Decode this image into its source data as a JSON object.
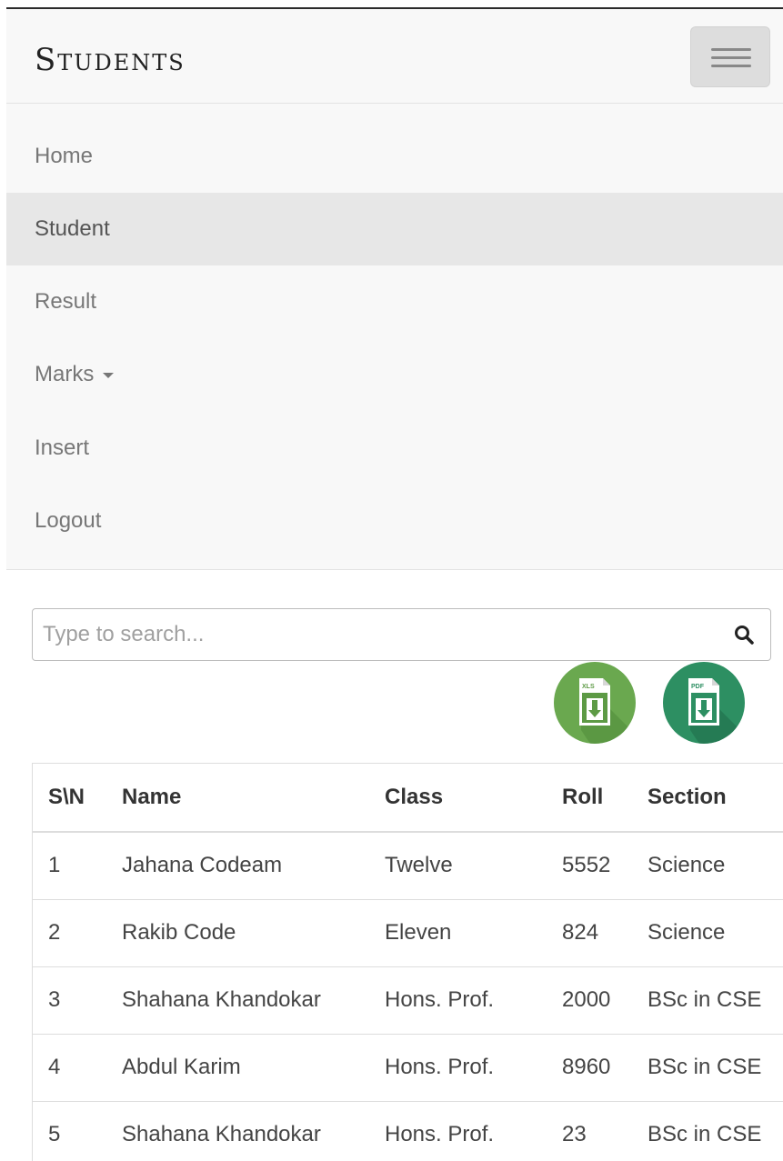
{
  "brand": "Students",
  "nav": {
    "items": [
      {
        "label": "Home"
      },
      {
        "label": "Student",
        "active": true
      },
      {
        "label": "Result"
      },
      {
        "label": "Marks",
        "dropdown": true
      },
      {
        "label": "Insert"
      },
      {
        "label": "Logout"
      }
    ]
  },
  "search": {
    "placeholder": "Type to search...",
    "value": ""
  },
  "exports": {
    "xls_label": "XLS",
    "pdf_label": "PDF"
  },
  "table": {
    "headers": [
      "S\\N",
      "Name",
      "Class",
      "Roll",
      "Section"
    ],
    "rows": [
      [
        "1",
        "Jahana Codeam",
        "Twelve",
        "5552",
        "Science"
      ],
      [
        "2",
        "Rakib Code",
        "Eleven",
        "824",
        "Science"
      ],
      [
        "3",
        "Shahana Khandokar",
        "Hons. Prof.",
        "2000",
        "BSc in CSE"
      ],
      [
        "4",
        "Abdul Karim",
        "Hons. Prof.",
        "8960",
        "BSc in CSE"
      ],
      [
        "5",
        "Shahana Khandokar",
        "Hons. Prof.",
        "23",
        "BSc in CSE"
      ]
    ]
  },
  "colors": {
    "navbar_bg": "#f8f8f8",
    "active_item_bg": "#e7e7e7",
    "xls_green": "#6aa84f",
    "pdf_green": "#2d8f62"
  },
  "icons": {
    "menu": "hamburger-icon",
    "search": "search-icon",
    "dropdown": "caret-down-icon",
    "xls": "xls-download-icon",
    "pdf": "pdf-download-icon"
  }
}
